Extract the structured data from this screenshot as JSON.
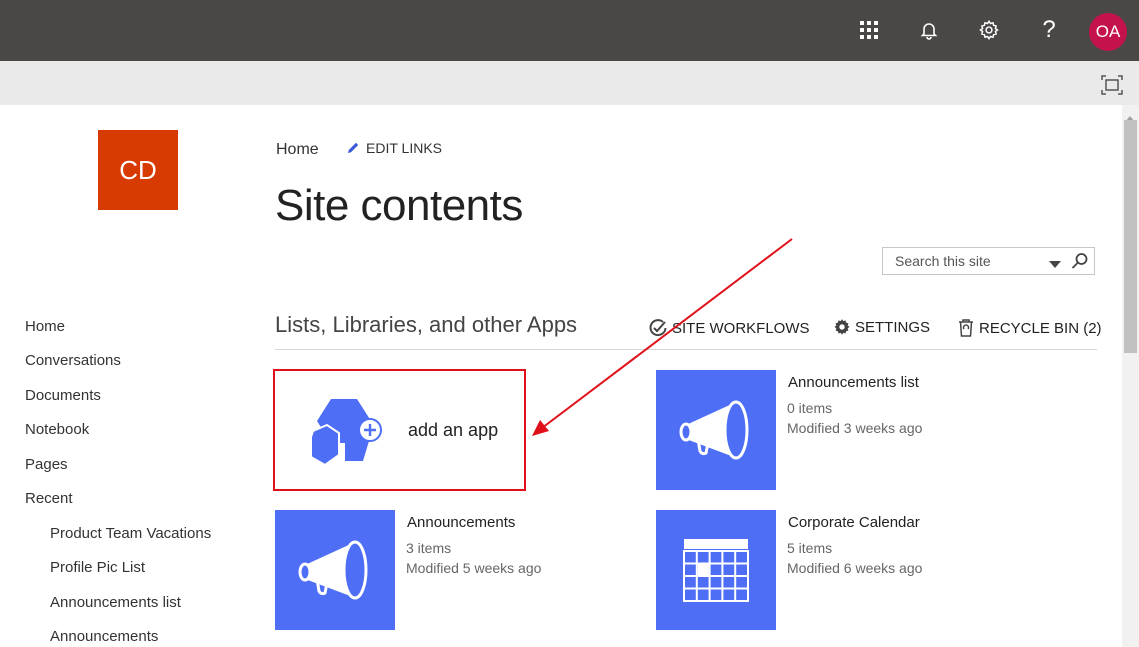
{
  "header": {
    "icons": [
      "app-launcher-icon",
      "bell-icon",
      "gear-icon",
      "help-icon"
    ],
    "help_glyph": "?",
    "user_initials": "OA",
    "avatar_color": "#c4124c"
  },
  "site": {
    "logo_initials": "CD",
    "logo_color": "#d83b01"
  },
  "breadcrumb": {
    "home": "Home",
    "edit_links": "EDIT LINKS"
  },
  "page": {
    "title": "Site contents"
  },
  "search": {
    "placeholder": "Search this site"
  },
  "leftnav": {
    "items": [
      "Home",
      "Conversations",
      "Documents",
      "Notebook",
      "Pages",
      "Recent"
    ],
    "recent": [
      "Product Team Vacations",
      "Profile Pic List",
      "Announcements list",
      "Announcements"
    ]
  },
  "section": {
    "title": "Lists, Libraries, and other Apps",
    "site_workflows": "SITE WORKFLOWS",
    "settings": "SETTINGS",
    "recycle_bin": "RECYCLE BIN (2)"
  },
  "add_app": {
    "label": "add an app"
  },
  "apps": [
    {
      "title": "Announcements list",
      "items": "0 items",
      "modified": "Modified 3 weeks ago",
      "icon": "megaphone-icon"
    },
    {
      "title": "Announcements",
      "items": "3 items",
      "modified": "Modified 5 weeks ago",
      "icon": "megaphone-icon"
    },
    {
      "title": "Corporate Calendar",
      "items": "5 items",
      "modified": "Modified 6 weeks ago",
      "icon": "calendar-icon"
    }
  ],
  "colors": {
    "tile": "#4d6ef5",
    "highlight": "#e0101a",
    "topbar": "#4a4847"
  }
}
